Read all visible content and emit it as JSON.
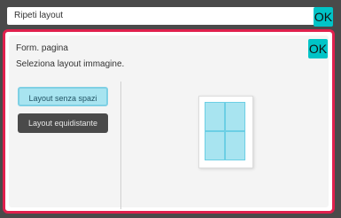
{
  "header": {
    "title": "Ripeti layout",
    "ok_label": "OK"
  },
  "panel": {
    "title": "Form. pagina",
    "subtitle": "Seleziona layout immagine.",
    "ok_label": "OK",
    "options": [
      {
        "label": "Layout senza spazi",
        "selected": true
      },
      {
        "label": "Layout equidistante",
        "selected": false
      }
    ]
  },
  "colors": {
    "accent": "#00c4c7",
    "highlight_border": "#e0204d",
    "selected_fill": "#a8e4f0"
  },
  "preview": {
    "layout_grid": "2x2"
  }
}
